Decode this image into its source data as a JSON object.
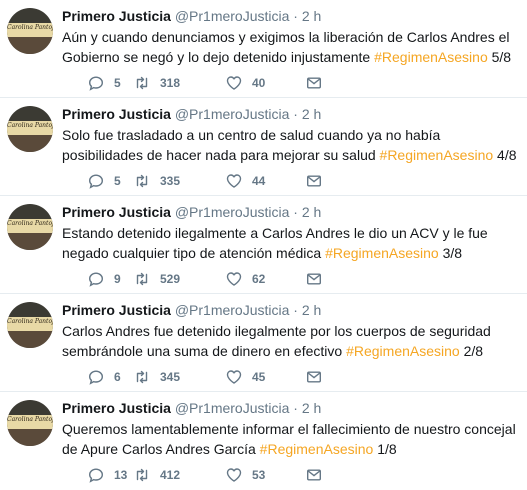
{
  "tweets": [
    {
      "name": "Primero Justicia",
      "handle": "@Pr1meroJusticia",
      "dot": "·",
      "time": "2 h",
      "text": "Aún y cuando denunciamos y exigimos la liberación de Carlos Andres el Gobierno se negó y lo dejo detenido injustamente",
      "hashtag": "#RegimenAsesino",
      "suffix": "5/8",
      "replies": "5",
      "retweets": "318",
      "likes": "40"
    },
    {
      "name": "Primero Justicia",
      "handle": "@Pr1meroJusticia",
      "dot": "·",
      "time": "2 h",
      "text": "Solo fue trasladado a un centro de salud cuando ya no había posibilidades de hacer nada para mejorar su salud ",
      "hashtag": "#RegimenAsesino",
      "suffix": "4/8",
      "replies": "5",
      "retweets": "335",
      "likes": "44"
    },
    {
      "name": "Primero Justicia",
      "handle": "@Pr1meroJusticia",
      "dot": "·",
      "time": "2 h",
      "text": "Estando detenido ilegalmente a Carlos Andres le dio un ACV y le fue negado cualquier tipo de atención médica",
      "hashtag": "#RegimenAsesino",
      "suffix": "3/8",
      "replies": "9",
      "retweets": "529",
      "likes": "62"
    },
    {
      "name": "Primero Justicia",
      "handle": "@Pr1meroJusticia",
      "dot": "·",
      "time": "2 h",
      "text": "Carlos Andres fue detenido ilegalmente por los cuerpos de seguridad sembrándole una suma de dinero en efectivo",
      "hashtag": "#RegimenAsesino",
      "suffix": "2/8",
      "replies": "6",
      "retweets": "345",
      "likes": "45"
    },
    {
      "name": "Primero Justicia",
      "handle": "@Pr1meroJusticia",
      "dot": "·",
      "time": "2 h",
      "text": "Queremos lamentablemente informar el fallecimiento de nuestro concejal de Apure Carlos Andres García",
      "hashtag": "#RegimenAsesino",
      "suffix": "1/8",
      "replies": "13",
      "retweets": "412",
      "likes": "53"
    }
  ],
  "avatar_text": "Carolina Pantojo",
  "icons": {
    "reply": "reply-icon",
    "retweet": "retweet-icon",
    "like": "heart-icon",
    "dm": "envelope-icon"
  },
  "colors": {
    "hashtag": "#f5a623",
    "muted": "#657786",
    "divider": "#e6ecf0"
  }
}
